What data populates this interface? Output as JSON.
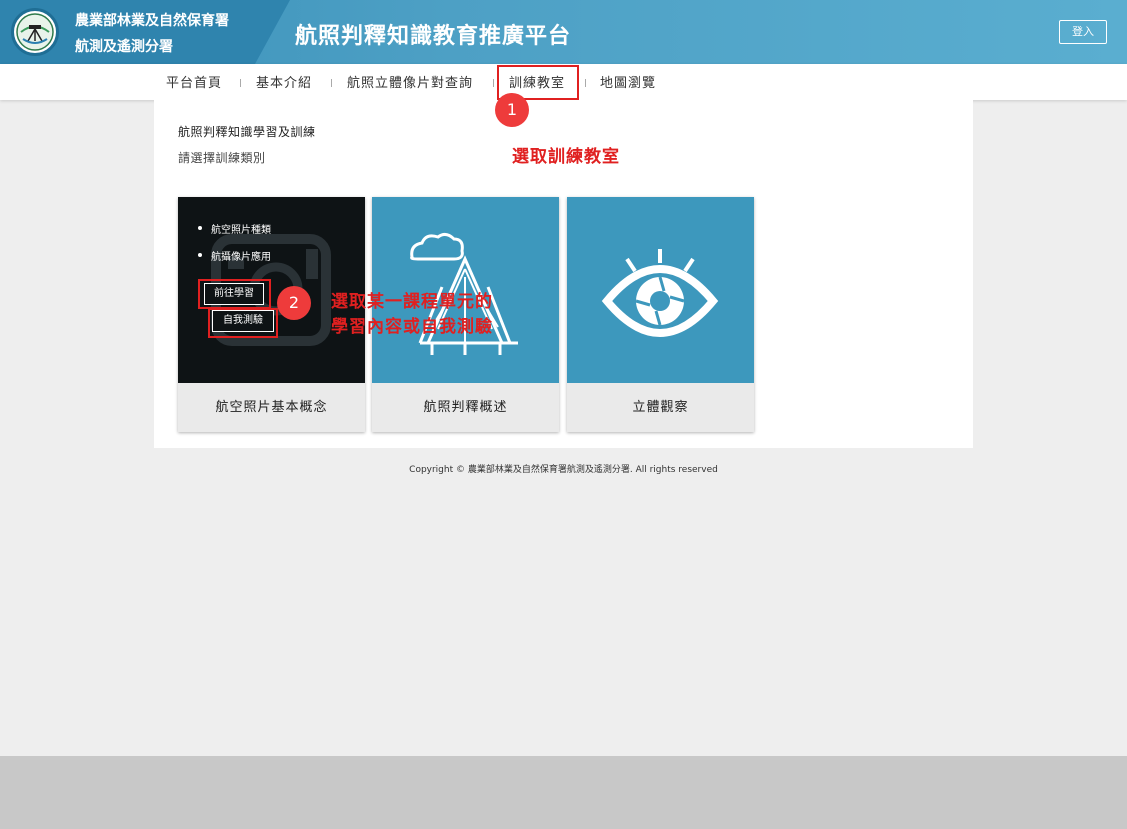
{
  "header": {
    "org_line1": "農業部林業及自然保育署",
    "org_line2": "航測及遙測分署",
    "platform_title": "航照判釋知識教育推廣平台",
    "login_label": "登入",
    "logo_icon": "agency-logo-icon"
  },
  "nav": {
    "items": [
      {
        "label": "平台首頁"
      },
      {
        "label": "基本介紹"
      },
      {
        "label": "航照立體像片對查詢"
      },
      {
        "label": "訓練教室"
      },
      {
        "label": "地圖瀏覽"
      }
    ]
  },
  "main": {
    "title": "航照判釋知識學習及訓練",
    "subtitle": "請選擇訓練類別",
    "cards": [
      {
        "label": "航空照片基本概念",
        "bullets": [
          "航空照片種類",
          "航攝像片應用"
        ],
        "learn_button": "前往學習",
        "test_button": "自我測驗",
        "icon": "camera-icon"
      },
      {
        "label": "航照判釋概述",
        "icon": "cloud-tree-icon"
      },
      {
        "label": "立體觀察",
        "icon": "eye-icon"
      }
    ]
  },
  "annotations": {
    "step1_number": "1",
    "step1_text": "選取訓練教室",
    "step2_number": "2",
    "step2_text_line1": "選取某一課程單元的",
    "step2_text_line2": "學習內容或自我測驗",
    "color": "#e02020"
  },
  "footer": {
    "copyright": "Copyright © 農業部林業及自然保育署航測及遙測分署. All rights reserved"
  }
}
